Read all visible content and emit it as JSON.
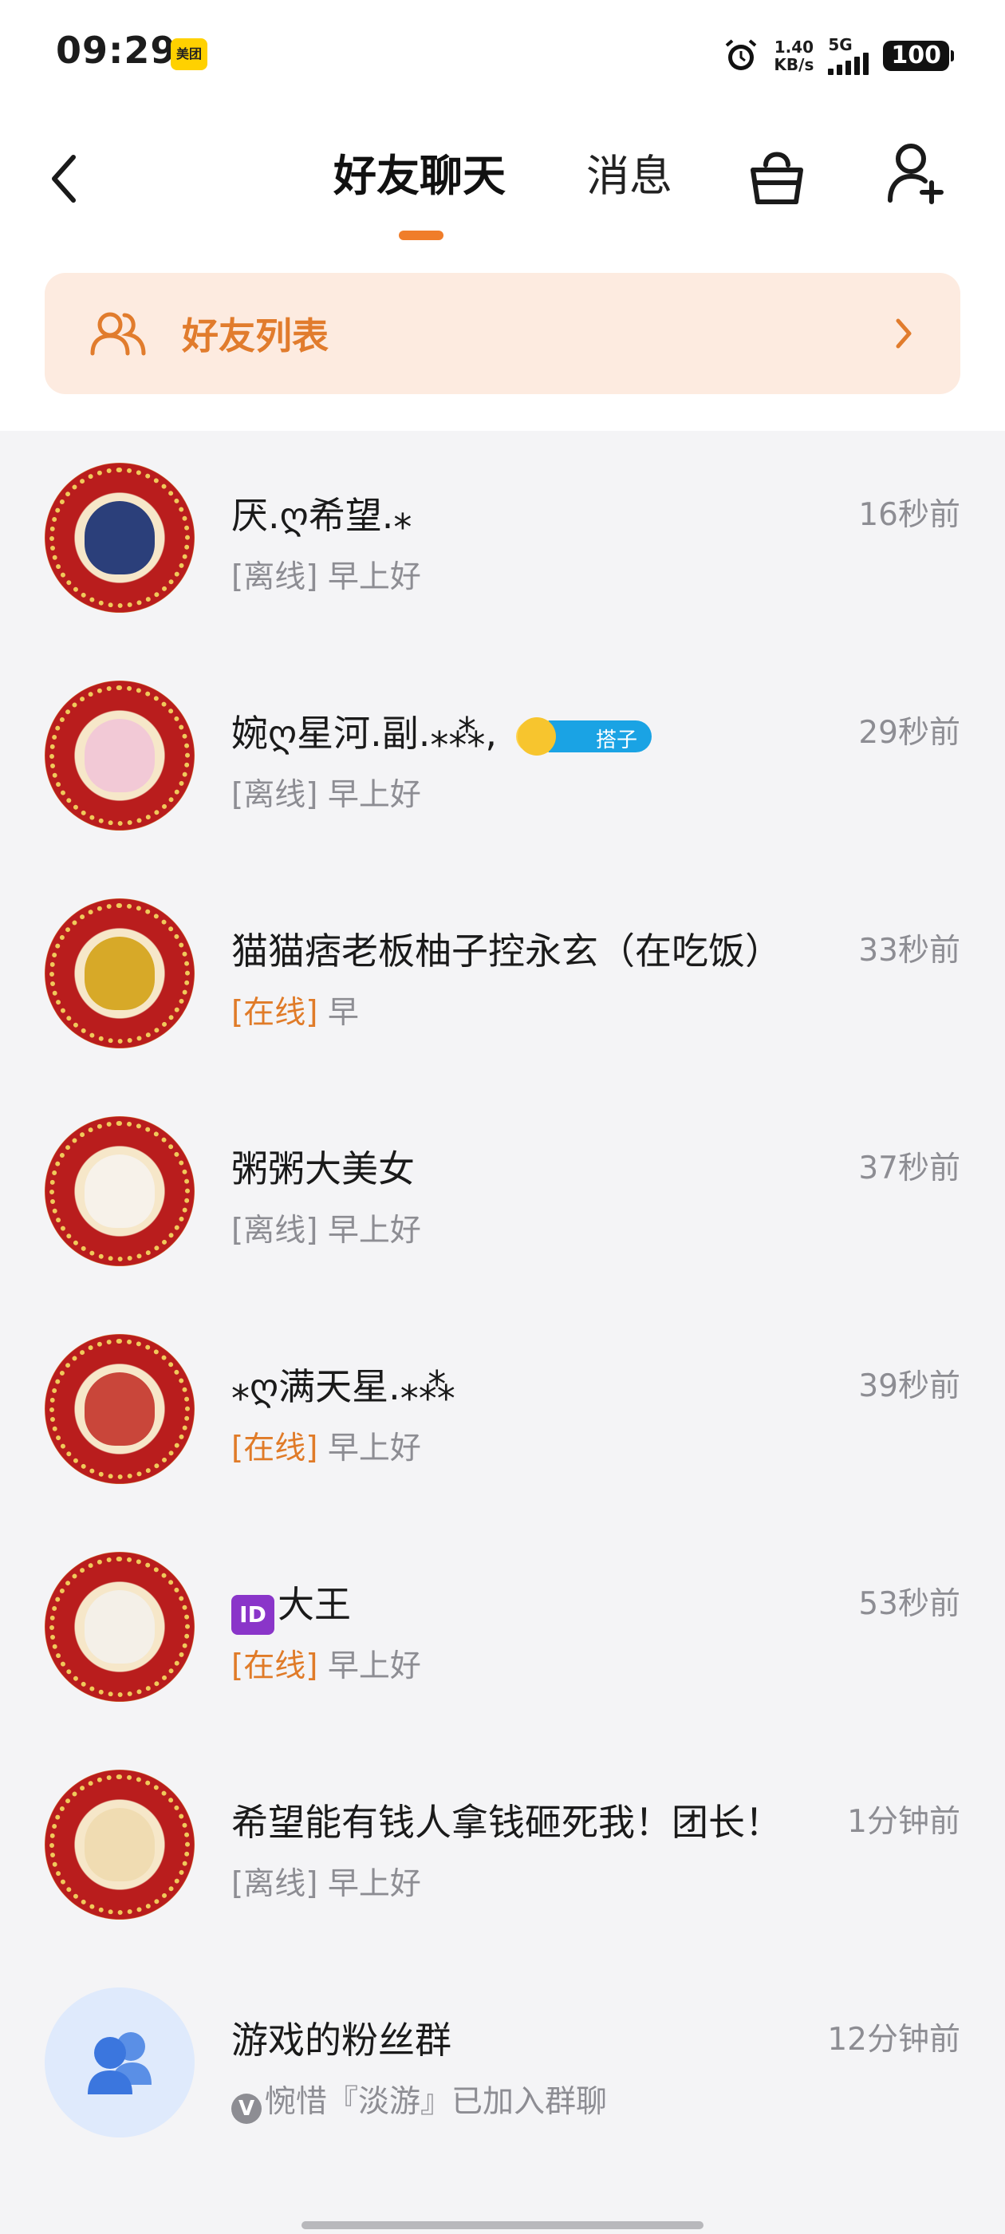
{
  "status_bar": {
    "time": "09:29",
    "app_badge": "美团",
    "net_speed_value": "1.40",
    "net_speed_unit": "KB/s",
    "network": "5G",
    "battery": "100"
  },
  "header": {
    "tab_friends": "好友聊天",
    "tab_messages": "消息",
    "accent_color": "#f07d2a"
  },
  "friend_list_entry": {
    "label": "好友列表"
  },
  "chats": [
    {
      "name": "厌.ღ希望.⁎",
      "time": "16秒前",
      "status": "[离线]",
      "online": false,
      "message": "早上好"
    },
    {
      "name": "婉ღ星河.副.⁎⁂,",
      "tag": "搭子",
      "time": "29秒前",
      "status": "[离线]",
      "online": false,
      "message": "早上好"
    },
    {
      "name": "猫猫痞老板柚子控永玄（在吃饭）",
      "time": "33秒前",
      "status": "[在线]",
      "online": true,
      "message": "早"
    },
    {
      "name": "粥粥大美女",
      "time": "37秒前",
      "status": "[离线]",
      "online": false,
      "message": "早上好"
    },
    {
      "name": "⁎ღ满天星.⁎⁂",
      "time": "39秒前",
      "status": "[在线]",
      "online": true,
      "message": "早上好"
    },
    {
      "name_badge": "ID",
      "name": "大王",
      "time": "53秒前",
      "status": "[在线]",
      "online": true,
      "message": "早上好"
    },
    {
      "name": "希望能有钱人拿钱砸死我！团长！",
      "time": "1分钟前",
      "status": "[离线]",
      "online": false,
      "message": "早上好"
    },
    {
      "name": "游戏的粉丝群",
      "time": "12分钟前",
      "v_badge": "V",
      "message": "惋惜『淡游』已加入群聊"
    }
  ]
}
